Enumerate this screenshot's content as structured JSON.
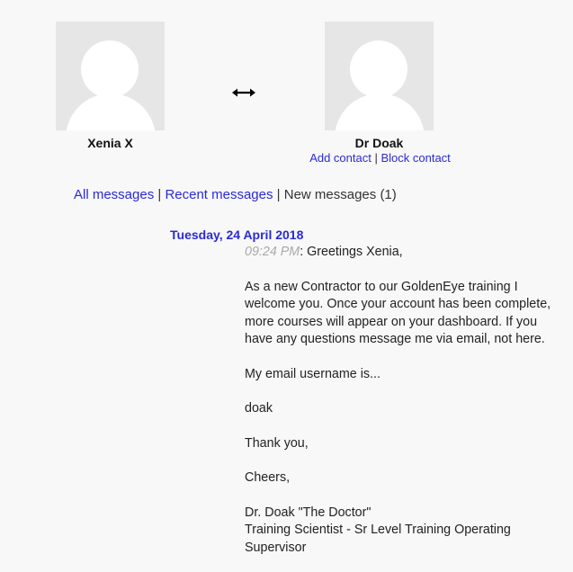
{
  "participants": {
    "left": {
      "name": "Xenia X"
    },
    "right": {
      "name": "Dr Doak",
      "add_contact": "Add contact",
      "separator": "|",
      "block_contact": "Block contact"
    }
  },
  "icons": {
    "between": "left-right-arrow-icon",
    "avatar": "default-user-avatar-icon"
  },
  "nav": {
    "all": "All messages",
    "sep1": " | ",
    "recent": "Recent messages",
    "sep2": " | ",
    "new": "New messages (1)"
  },
  "conversation": {
    "date": "Tuesday, 24 April 2018",
    "message": {
      "time": "09:24 PM",
      "greeting": ": Greetings Xenia,",
      "para1": "As a new Contractor to our GoldenEye training I welcome you. Once your account has been complete, more courses will appear on your dashboard. If you have any questions message me via email, not here.",
      "para2": "My email username is...",
      "para3": "doak",
      "para4": "Thank you,",
      "para5": "Cheers,",
      "sig1": "Dr. Doak \"The Doctor\"",
      "sig2": "Training Scientist - Sr Level Training Operating Supervisor"
    }
  },
  "colors": {
    "link": "#2a2ad6",
    "background": "#f8f8f8",
    "avatar_bg": "#e6e6e6",
    "time": "#a9a9a9"
  }
}
